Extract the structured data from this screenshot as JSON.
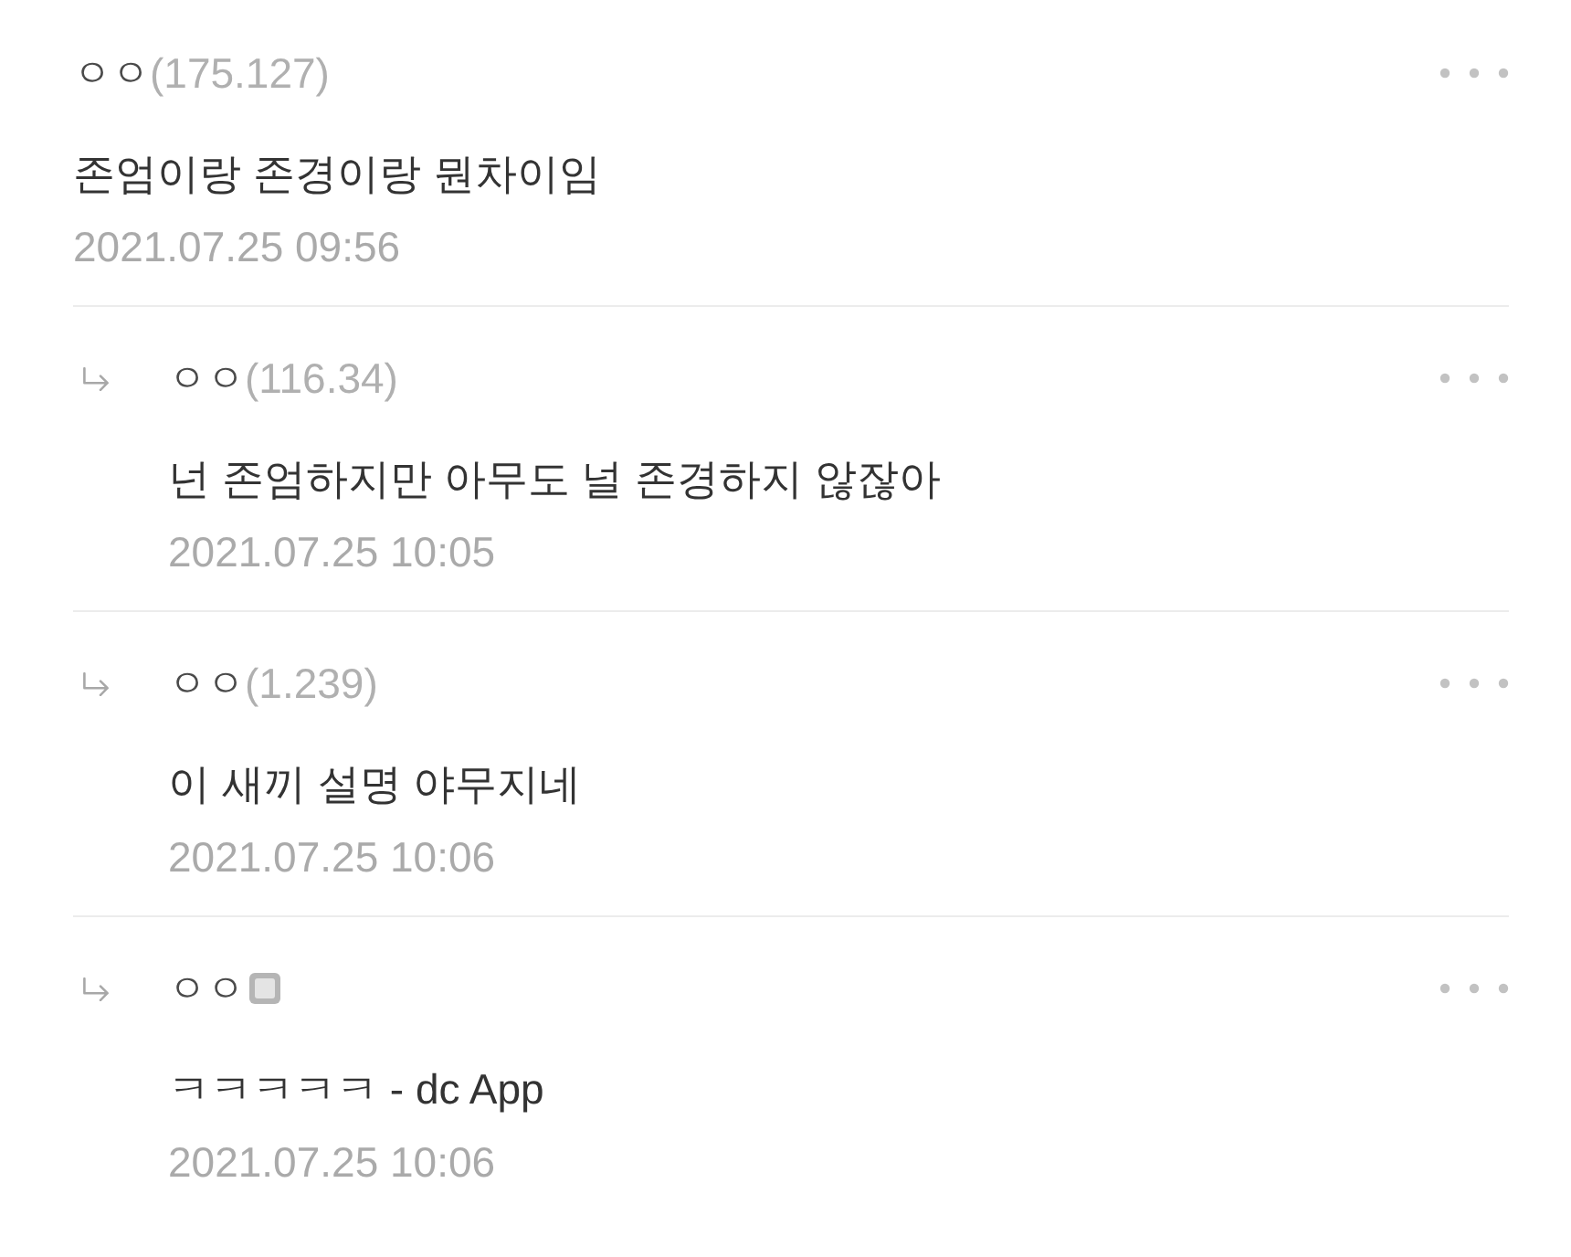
{
  "comment": {
    "nickname": "ㅇㅇ",
    "ip": "(175.127)",
    "badge": false,
    "text": "존엄이랑 존경이랑 뭔차이임",
    "date": "2021.07.25 09:56",
    "replies": [
      {
        "nickname": "ㅇㅇ",
        "ip": "(116.34)",
        "badge": false,
        "text": "넌 존엄하지만 아무도 널 존경하지 않잖아",
        "date": "2021.07.25 10:05"
      },
      {
        "nickname": "ㅇㅇ",
        "ip": "(1.239)",
        "badge": false,
        "text": "이 새끼 설명 야무지네",
        "date": "2021.07.25 10:06"
      },
      {
        "nickname": "ㅇㅇ",
        "badge": true,
        "text": "ㅋㅋㅋㅋㅋ - dc App",
        "date": "2021.07.25 10:06"
      }
    ]
  }
}
